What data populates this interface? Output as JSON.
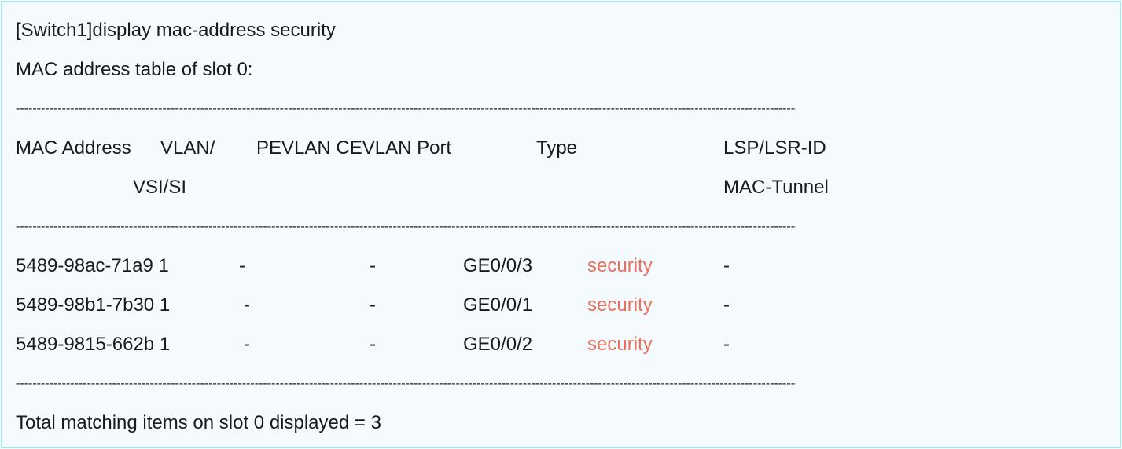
{
  "command": "[Switch1]display mac-address security",
  "slot_heading": "MAC address table of slot 0:",
  "separator": "--------------------------------------------------------------------------------------------------------------------------------------------------------------------------------------------------------------",
  "headers": {
    "mac_address": "MAC Address",
    "vlan": "VLAN/",
    "vsi_si": "VSI/SI",
    "pevlan_cevlan_port": "PEVLAN CEVLAN Port",
    "type": "Type",
    "lsp_lsr_id": "LSP/LSR-ID",
    "mac_tunnel": "MAC-Tunnel"
  },
  "rows": [
    {
      "mac_vlan": "5489-98ac-71a9 1",
      "pevlan": "-",
      "cevlan": "-",
      "port": "GE0/0/3",
      "type": "security",
      "lsp": "-"
    },
    {
      "mac_vlan": "5489-98b1-7b30 1",
      "pevlan": "-",
      "cevlan": "-",
      "port": "GE0/0/1",
      "type": "security",
      "lsp": "-"
    },
    {
      "mac_vlan": "5489-9815-662b 1",
      "pevlan": "-",
      "cevlan": "-",
      "port": "GE0/0/2",
      "type": "security",
      "lsp": "-"
    }
  ],
  "total": "Total matching items on slot 0 displayed = 3",
  "colors": {
    "security_type": "#e8705f",
    "panel_background": "#f4fafd",
    "panel_border": "#a8e4f0"
  }
}
